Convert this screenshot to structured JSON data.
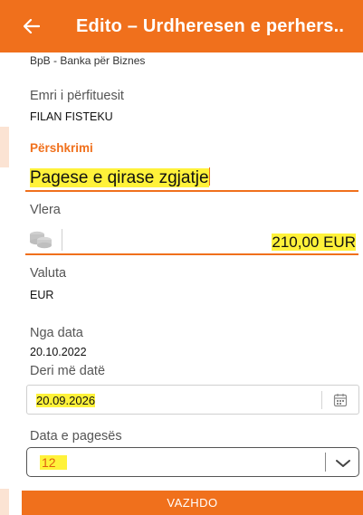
{
  "header": {
    "title": "Edito – Urdheresen e perhers.."
  },
  "bank": {
    "name": "BpB - Banka për Biznes"
  },
  "beneficiary": {
    "label": "Emri i përfituesit",
    "value": "FILAN FISTEKU"
  },
  "description": {
    "label": "Përshkrimi",
    "value": "Pagese e qirase zgjatje"
  },
  "amount": {
    "label": "Vlera",
    "value": "210,00 EUR"
  },
  "currency": {
    "label": "Valuta",
    "value": "EUR"
  },
  "from_date": {
    "label": "Nga data",
    "value": "20.10.2022"
  },
  "to_date": {
    "label": "Deri më datë",
    "value": "20.09.2026"
  },
  "payment_day": {
    "label": "Data e pagesës",
    "value": "12"
  },
  "continue_button": {
    "label": "VAZHDO"
  },
  "colors": {
    "accent": "#f0701c",
    "highlight": "#fff23a"
  }
}
